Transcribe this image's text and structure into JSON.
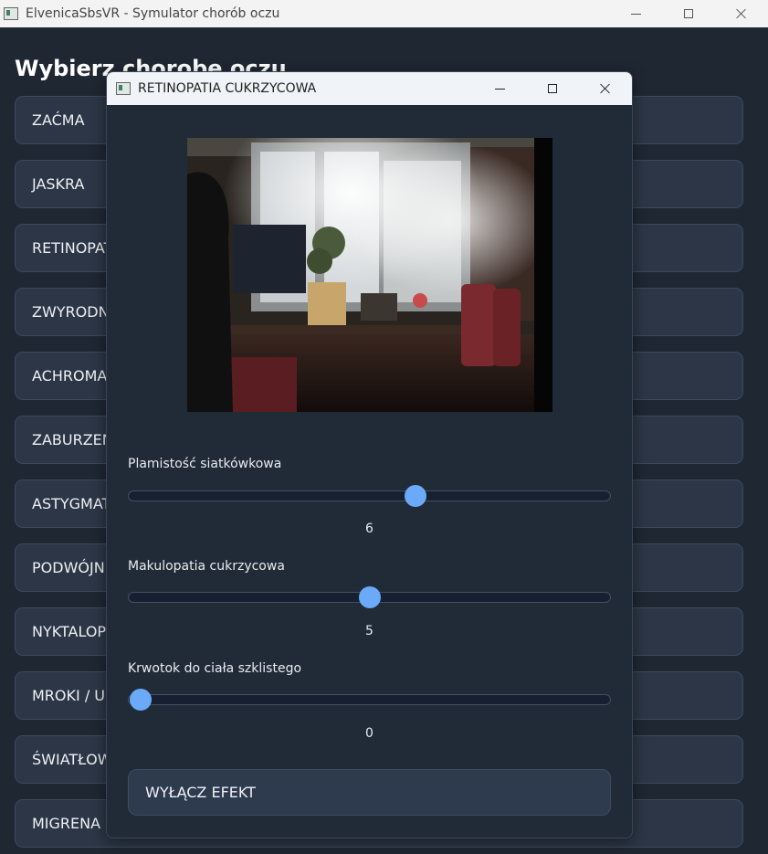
{
  "window": {
    "title": "ElvenicaSbsVR - Symulator chorób oczu"
  },
  "main": {
    "heading": "Wybierz chorobę oczu",
    "diseases": [
      {
        "label": "ZAĆMA"
      },
      {
        "label": "JASKRA"
      },
      {
        "label": "RETINOPATIA CUKRZYCOWA"
      },
      {
        "label": "ZWYRODNIENIE PLAMKI"
      },
      {
        "label": "ACHROMATOPSJA"
      },
      {
        "label": "ZABURZENIA"
      },
      {
        "label": "ASTYGMATYZM"
      },
      {
        "label": "PODWÓJNE WIDZENIE"
      },
      {
        "label": "NYKTALOPIA"
      },
      {
        "label": "MROKI / UBYTKI"
      },
      {
        "label": "ŚWIATŁOWSTRĘT"
      },
      {
        "label": "MIGRENA"
      }
    ]
  },
  "dialog": {
    "title": "RETINOPATIA CUKRZYCOWA",
    "sliders": [
      {
        "label": "Plamistość siatkówkowa",
        "value": "6",
        "fraction": 0.6
      },
      {
        "label": "Makulopatia cukrzycowa",
        "value": "5",
        "fraction": 0.5
      },
      {
        "label": "Krwotok do ciała szklistego",
        "value": "0",
        "fraction": 0.0
      }
    ],
    "off_button": "WYŁĄCZ EFEKT"
  },
  "colors": {
    "background": "#1f2733",
    "button": "#2c3646",
    "accent": "#6aaaf8"
  }
}
